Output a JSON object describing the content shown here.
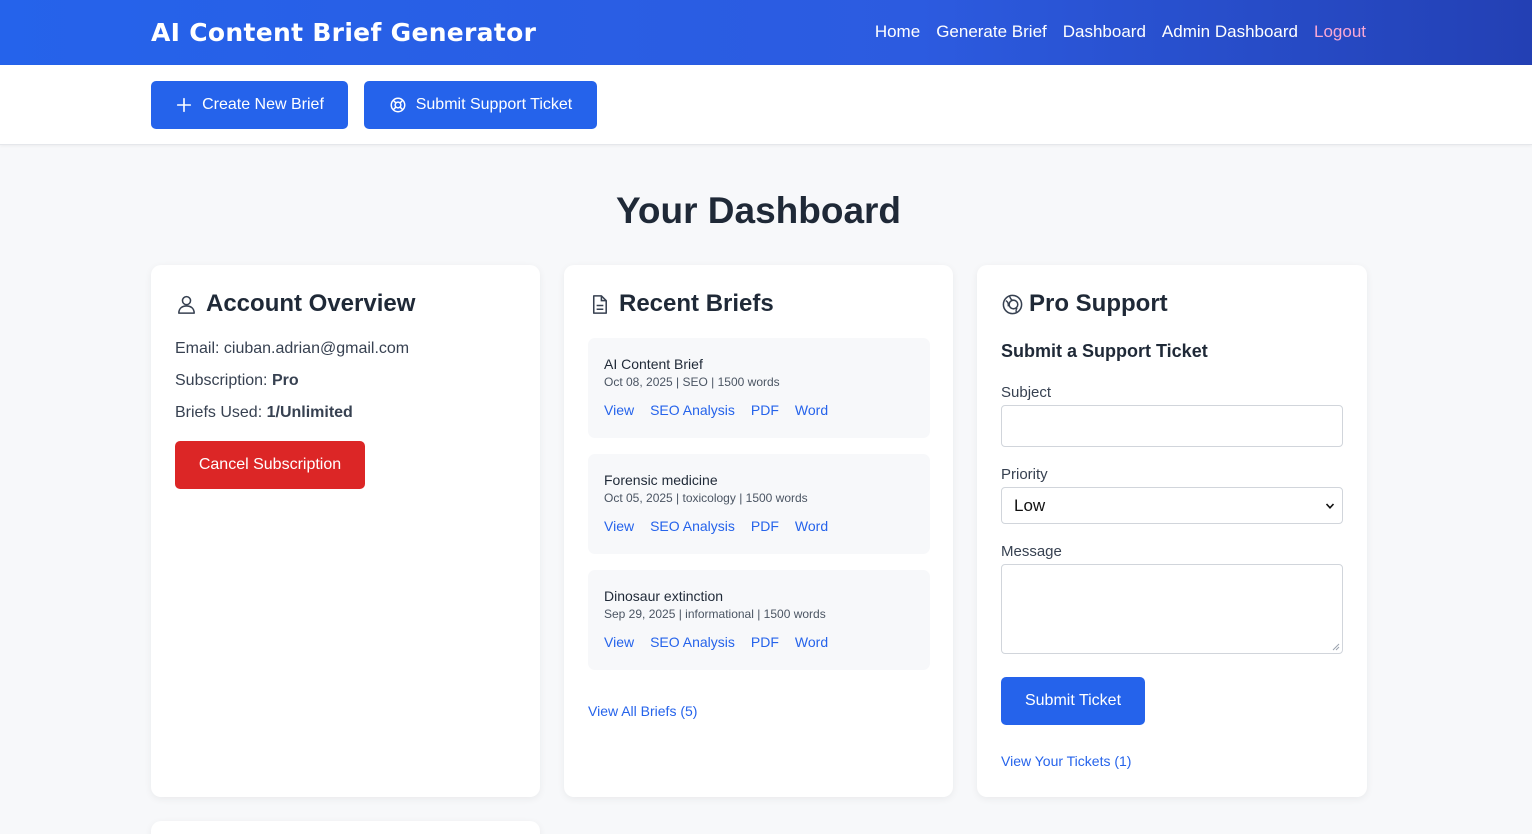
{
  "header": {
    "brand": "AI Content Brief Generator",
    "nav": [
      "Home",
      "Generate Brief",
      "Dashboard",
      "Admin Dashboard"
    ],
    "logout": "Logout"
  },
  "actions": {
    "create_brief": "Create New Brief",
    "submit_ticket": "Submit Support Ticket"
  },
  "page_title": "Your Dashboard",
  "account": {
    "title": "Account Overview",
    "email_label": "Email:",
    "email": "ciuban.adrian@gmail.com",
    "subscription_label": "Subscription:",
    "subscription": "Pro",
    "briefs_used_label": "Briefs Used:",
    "briefs_used": "1/Unlimited",
    "cancel_button": "Cancel Subscription"
  },
  "recent_briefs": {
    "title": "Recent Briefs",
    "items": [
      {
        "title": "AI Content Brief",
        "meta": "Oct 08, 2025 | SEO | 1500 words"
      },
      {
        "title": "Forensic medicine",
        "meta": "Oct 05, 2025 | toxicology | 1500 words"
      },
      {
        "title": "Dinosaur extinction",
        "meta": "Sep 29, 2025 | informational | 1500 words"
      }
    ],
    "links": [
      "View",
      "SEO Analysis",
      "PDF",
      "Word"
    ],
    "view_all": "View All Briefs (5)"
  },
  "support": {
    "title": "Pro Support",
    "form_heading": "Submit a Support Ticket",
    "subject_label": "Subject",
    "subject_value": "",
    "priority_label": "Priority",
    "priority_value": "Low",
    "message_label": "Message",
    "message_value": "",
    "submit_button": "Submit Ticket",
    "view_tickets": "View Your Tickets (1)"
  },
  "colors": {
    "primary": "#2563eb",
    "danger": "#dc2626",
    "logout": "#f9a8d4"
  }
}
